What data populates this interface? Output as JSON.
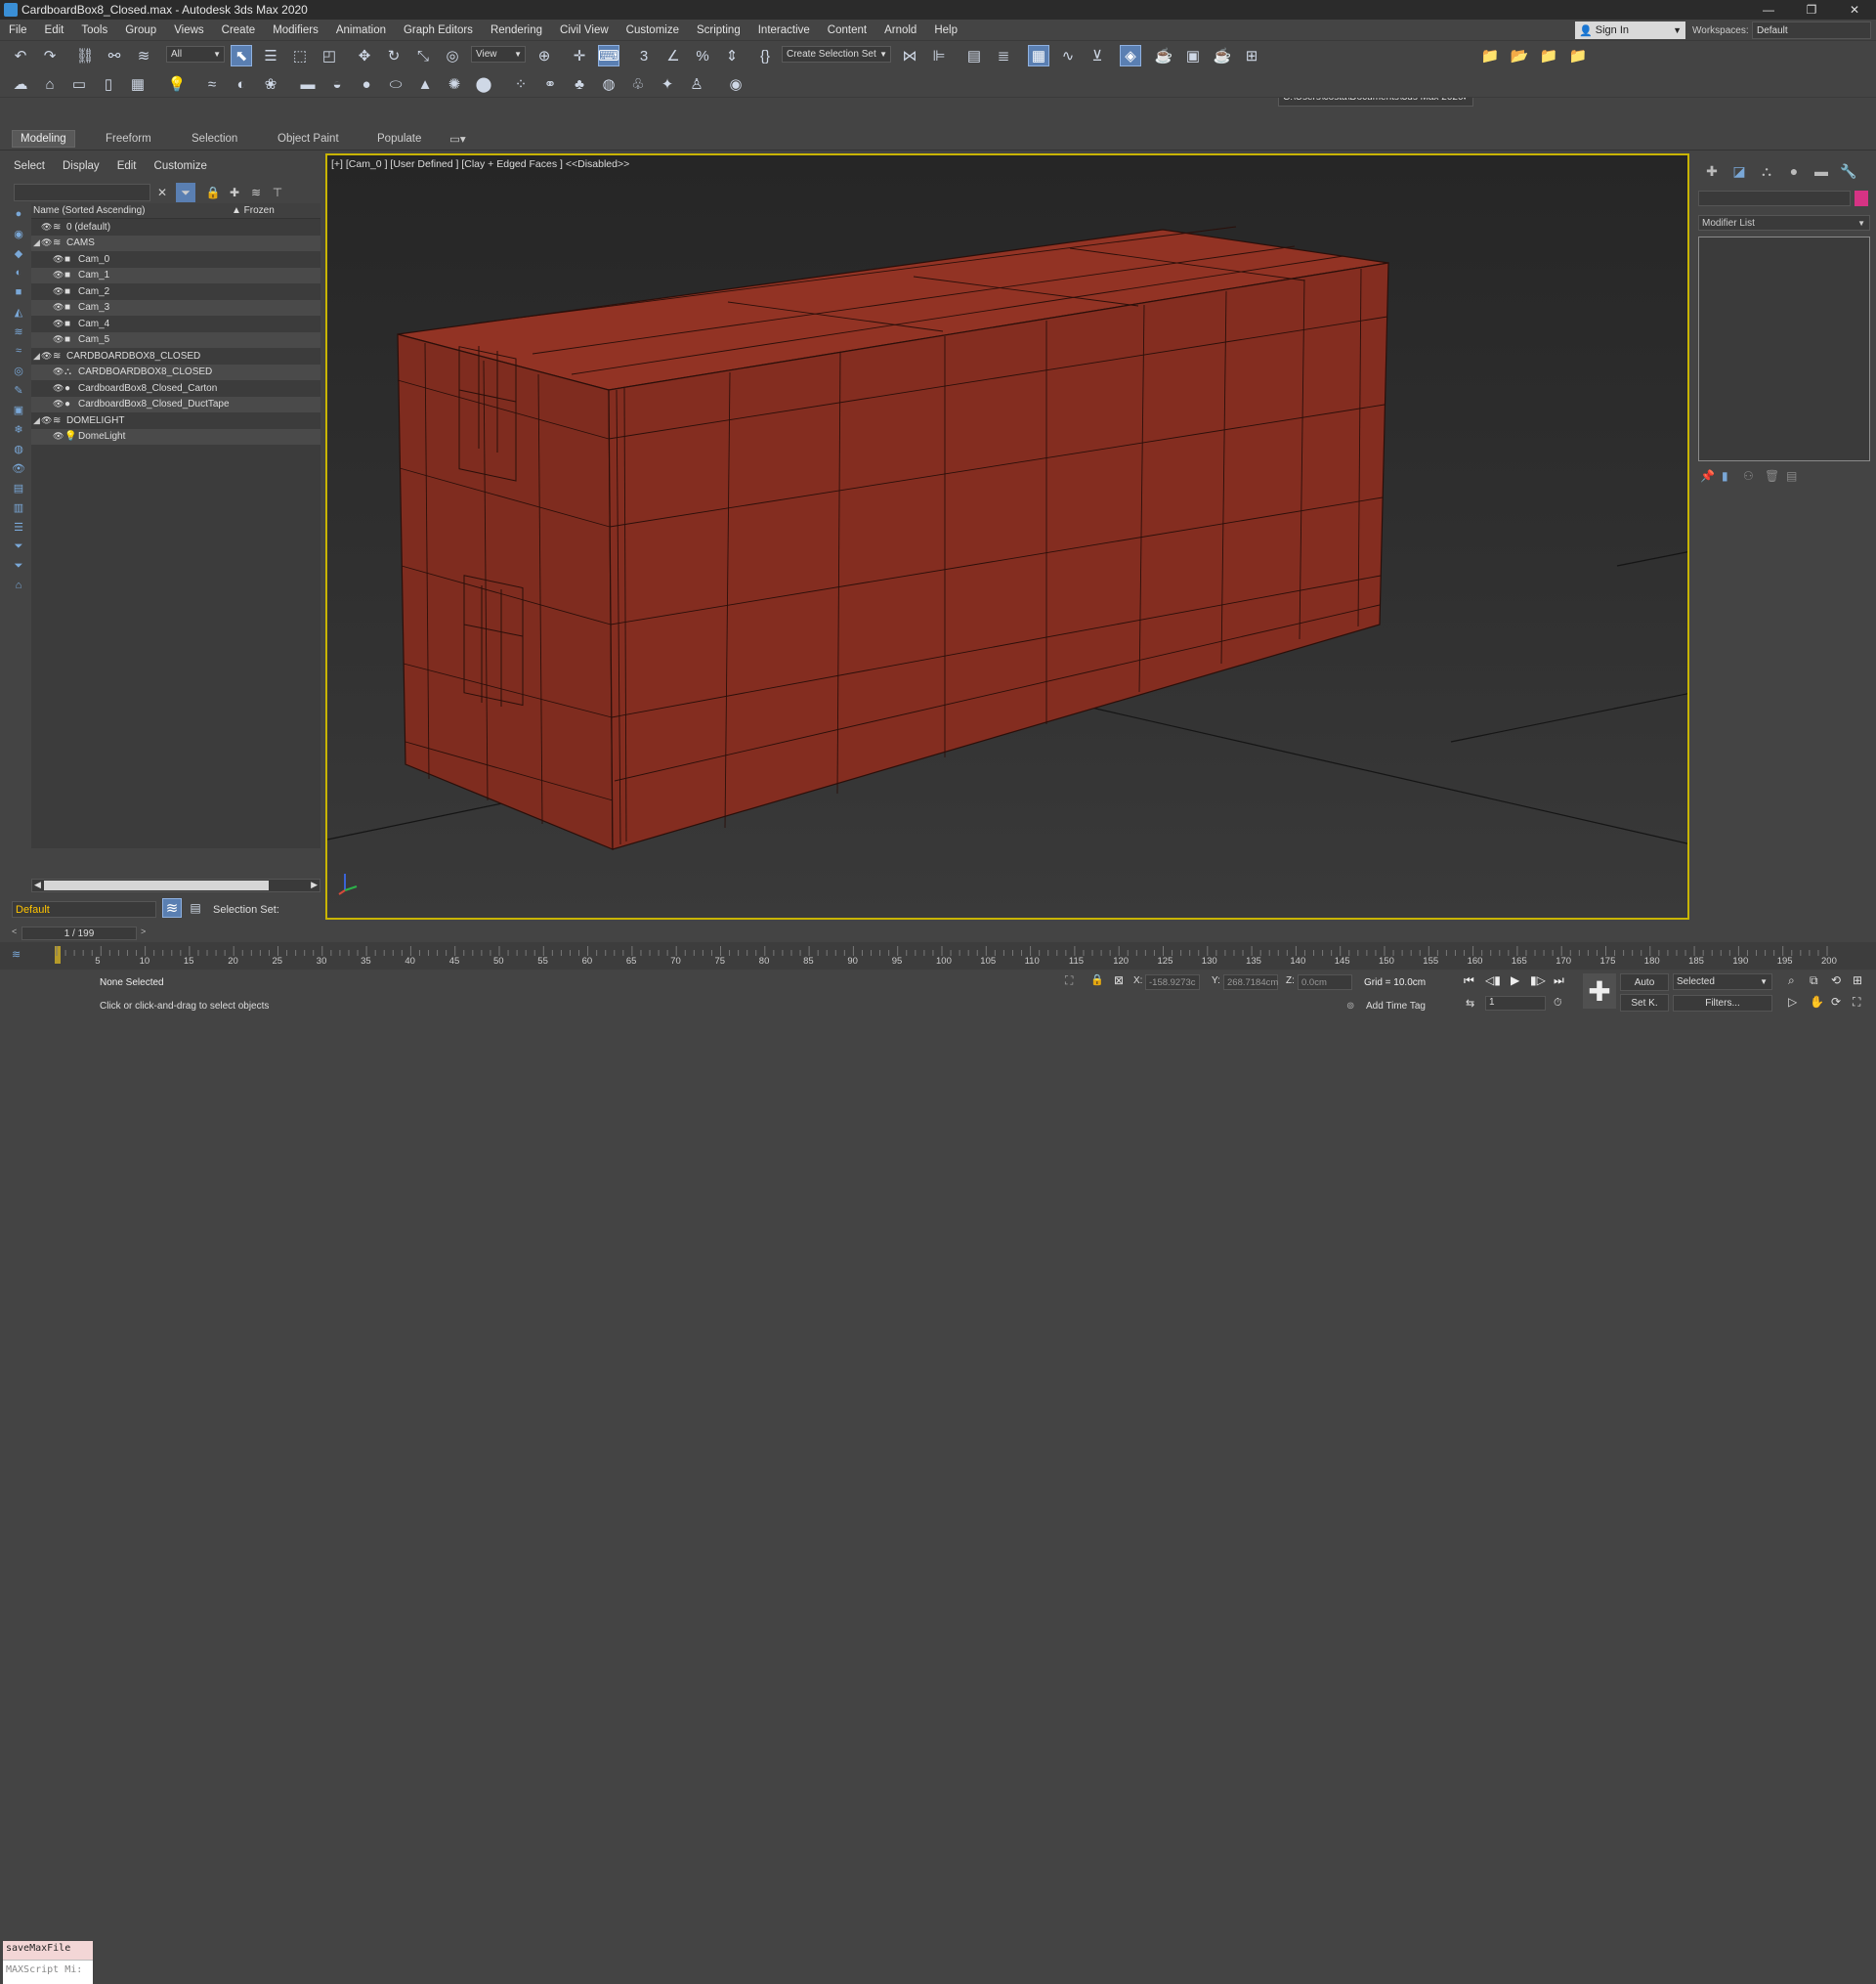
{
  "window": {
    "title": "CardboardBox8_Closed.max - Autodesk 3ds Max 2020",
    "min": "—",
    "restore": "❐",
    "close": "✕"
  },
  "menu": [
    "File",
    "Edit",
    "Tools",
    "Group",
    "Views",
    "Create",
    "Modifiers",
    "Animation",
    "Graph Editors",
    "Rendering",
    "Civil View",
    "Customize",
    "Scripting",
    "Interactive",
    "Content",
    "Arnold",
    "Help"
  ],
  "signin": "Sign In",
  "workspaces_label": "Workspaces:",
  "workspace": "Default",
  "toolbar": {
    "filter_all": "All",
    "ref_coord": "View",
    "create_selection_set": "Create Selection Set",
    "project_path": "C:\\Users\\costa\\Documents\\3ds Max 2020"
  },
  "ribbon_tabs": [
    "Modeling",
    "Freeform",
    "Selection",
    "Object Paint",
    "Populate"
  ],
  "scene_explorer": {
    "menu": [
      "Select",
      "Display",
      "Edit",
      "Customize"
    ],
    "col_name": "Name (Sorted Ascending)",
    "col_frozen": "▲ Frozen",
    "rows": [
      {
        "label": "0 (default)",
        "level": 0,
        "icon": "layer",
        "expand": ""
      },
      {
        "label": "CAMS",
        "level": 0,
        "icon": "layer",
        "expand": "◢"
      },
      {
        "label": "Cam_0",
        "level": 1,
        "icon": "camera",
        "expand": ""
      },
      {
        "label": "Cam_1",
        "level": 1,
        "icon": "camera",
        "expand": ""
      },
      {
        "label": "Cam_2",
        "level": 1,
        "icon": "camera",
        "expand": ""
      },
      {
        "label": "Cam_3",
        "level": 1,
        "icon": "camera",
        "expand": ""
      },
      {
        "label": "Cam_4",
        "level": 1,
        "icon": "camera",
        "expand": ""
      },
      {
        "label": "Cam_5",
        "level": 1,
        "icon": "camera",
        "expand": ""
      },
      {
        "label": "CARDBOARDBOX8_CLOSED",
        "level": 0,
        "icon": "layer",
        "expand": "◢"
      },
      {
        "label": "CARDBOARDBOX8_CLOSED",
        "level": 1,
        "icon": "group",
        "expand": ""
      },
      {
        "label": "CardboardBox8_Closed_Carton",
        "level": 1,
        "icon": "sphere",
        "expand": ""
      },
      {
        "label": "CardboardBox8_Closed_DuctTape",
        "level": 1,
        "icon": "sphere",
        "expand": ""
      },
      {
        "label": "DOMELIGHT",
        "level": 0,
        "icon": "layer",
        "expand": "◢"
      },
      {
        "label": "DomeLight",
        "level": 1,
        "icon": "light",
        "expand": ""
      }
    ]
  },
  "layer": "Default",
  "selection_set_label": "Selection Set:",
  "viewport": {
    "label": "[+] [Cam_0 ] [User Defined ] [Clay + Edged Faces ] <<Disabled>>",
    "object_color": "#8a2e22"
  },
  "command_panel": {
    "modifier_list": "Modifier List",
    "swatch_color": "#d63384"
  },
  "timeslider": {
    "frame": "1 / 199"
  },
  "timeline_ticks": [
    "5",
    "10",
    "15",
    "20",
    "25",
    "30",
    "35",
    "40",
    "45",
    "50",
    "55",
    "60",
    "65",
    "70",
    "75",
    "80",
    "85",
    "90",
    "95",
    "100",
    "105",
    "110",
    "115",
    "120",
    "125",
    "130",
    "135",
    "140",
    "145",
    "150",
    "155",
    "160",
    "165",
    "170",
    "175",
    "180",
    "185",
    "190",
    "195",
    "200"
  ],
  "status": {
    "maxscript_line1": "saveMaxFile",
    "maxscript_line2": "MAXScript Mi:",
    "selection": "None Selected",
    "prompt": "Click or click-and-drag to select objects",
    "x_label": "X:",
    "x_val": "-158.9273c",
    "y_label": "Y:",
    "y_val": "268.7184cm",
    "z_label": "Z:",
    "z_val": "0.0cm",
    "grid": "Grid = 10.0cm",
    "add_time_tag": "Add Time Tag",
    "auto": "Auto",
    "set_k": "Set K.",
    "key_set": "Selected",
    "filters": "Filters...",
    "frame": "1"
  }
}
